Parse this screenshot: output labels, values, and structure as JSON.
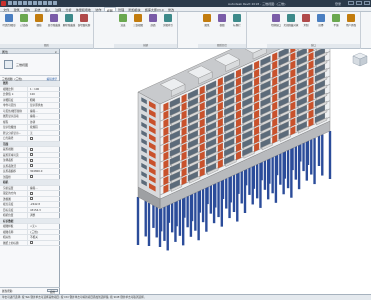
{
  "window": {
    "title": "Autodesk Revit 2018",
    "document": "三维视图: {三维}",
    "signin": "登录"
  },
  "ribbon_tabs": [
    "文件",
    "建筑",
    "结构",
    "系统",
    "插入",
    "注释",
    "分析",
    "体量和场地",
    "协作",
    "视图",
    "管理",
    "附加模块",
    "族库大师V3.0",
    "修改"
  ],
  "ribbon_active_tab": "视图",
  "ribbon_groups": [
    {
      "label": "图形",
      "buttons": [
        "可见性/图形",
        "过滤器",
        "细线",
        "显示隐藏线",
        "删除隐藏线",
        "剖切面轮廓"
      ]
    },
    {
      "label": "创建",
      "buttons": [
        "渲染",
        "三维视图",
        "剖面",
        "详图索引"
      ]
    },
    {
      "label": "图纸组合",
      "buttons": [
        "图纸",
        "视图",
        "标题栏"
      ]
    },
    {
      "label": "窗口",
      "buttons": [
        "切换窗口",
        "关闭隐藏对象",
        "复制",
        "层叠",
        "平铺",
        "用户界面"
      ]
    }
  ],
  "properties": {
    "header": "属性",
    "type_name": "三维视图",
    "instance_selector": "三维视图: {三维}",
    "edit_type": "编辑类型",
    "rows": [
      {
        "section": true,
        "label": "图形"
      },
      {
        "label": "视图比例",
        "value": "1 : 100"
      },
      {
        "label": "比例值 1:",
        "value": "100"
      },
      {
        "label": "详细程度",
        "value": "粗略"
      },
      {
        "label": "零件可见性",
        "value": "显示原状态"
      },
      {
        "label": "可见性/图形替换",
        "value": "编辑..."
      },
      {
        "label": "图形显示选项",
        "value": "编辑..."
      },
      {
        "label": "规程",
        "value": "协调"
      },
      {
        "label": "显示隐藏线",
        "value": "按规程"
      },
      {
        "label": "默认分析显示...",
        "value": "无"
      },
      {
        "label": "日光路径",
        "value": ""
      },
      {
        "section": true,
        "label": "范围"
      },
      {
        "label": "裁剪视图",
        "value": ""
      },
      {
        "label": "裁剪区域可见",
        "value": ""
      },
      {
        "label": "注释裁剪",
        "value": ""
      },
      {
        "label": "远剪裁激活",
        "value": ""
      },
      {
        "label": "远剪裁偏移",
        "value": "304800.0"
      },
      {
        "label": "剖面框",
        "value": ""
      },
      {
        "section": true,
        "label": "相机"
      },
      {
        "label": "渲染设置",
        "value": "编辑..."
      },
      {
        "label": "锁定的方向",
        "value": ""
      },
      {
        "label": "透视图",
        "value": ""
      },
      {
        "label": "视点高度",
        "value": "-2642.8"
      },
      {
        "label": "目标高度",
        "value": "43154.3"
      },
      {
        "label": "相机位置",
        "value": "调整"
      },
      {
        "section": true,
        "label": "标识数据"
      },
      {
        "label": "视图样板",
        "value": "<无>"
      },
      {
        "label": "视图名称",
        "value": "{三维}"
      },
      {
        "label": "相关性",
        "value": "不相关"
      },
      {
        "label": "图纸上的标题",
        "value": ""
      }
    ],
    "help_link": "属性帮助",
    "apply": "应用"
  },
  "statusbar": {
    "text": "单击可进行选择; 按 Tab 键并单击可选择其他项目; 按 Ctrl 键并单击可将新项目添加到选择集; 按 Shift 键并单击可取消选择。"
  },
  "colors": {
    "titlebar": "#2b3a4a",
    "brick": "#c9522c",
    "window_frame": "#6a6f75",
    "slab": "#a8aaad",
    "pile": "#2b4c9a",
    "balcony": "#d9d9d9"
  },
  "icons": [
    "app-logo-icon",
    "save-icon",
    "undo-icon",
    "redo-icon",
    "close-icon",
    "viewcube-icon"
  ]
}
